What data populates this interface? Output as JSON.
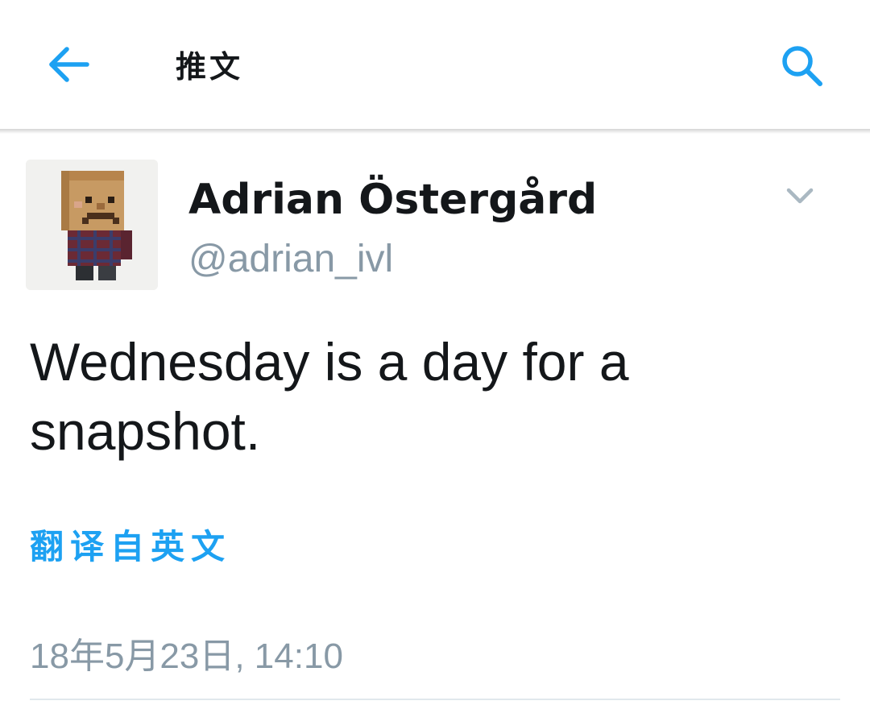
{
  "header": {
    "title": "推文",
    "back_icon": "arrow-left-icon",
    "search_icon": "search-icon"
  },
  "tweet": {
    "author_name": "Adrian Östergård",
    "author_handle": "@adrian_ivl",
    "text_line1": "Wednesday is a day for a",
    "text_line2": "snapshot.",
    "translate_label": "翻译自英文",
    "timestamp": "18年5月23日, 14:10",
    "avatar_icon": "avatar-blocky-character",
    "caret_icon": "chevron-down-icon"
  },
  "colors": {
    "accent": "#1da1f2",
    "text_primary": "#14171a",
    "text_secondary": "#8899a6",
    "divider": "#e1e8ed"
  }
}
